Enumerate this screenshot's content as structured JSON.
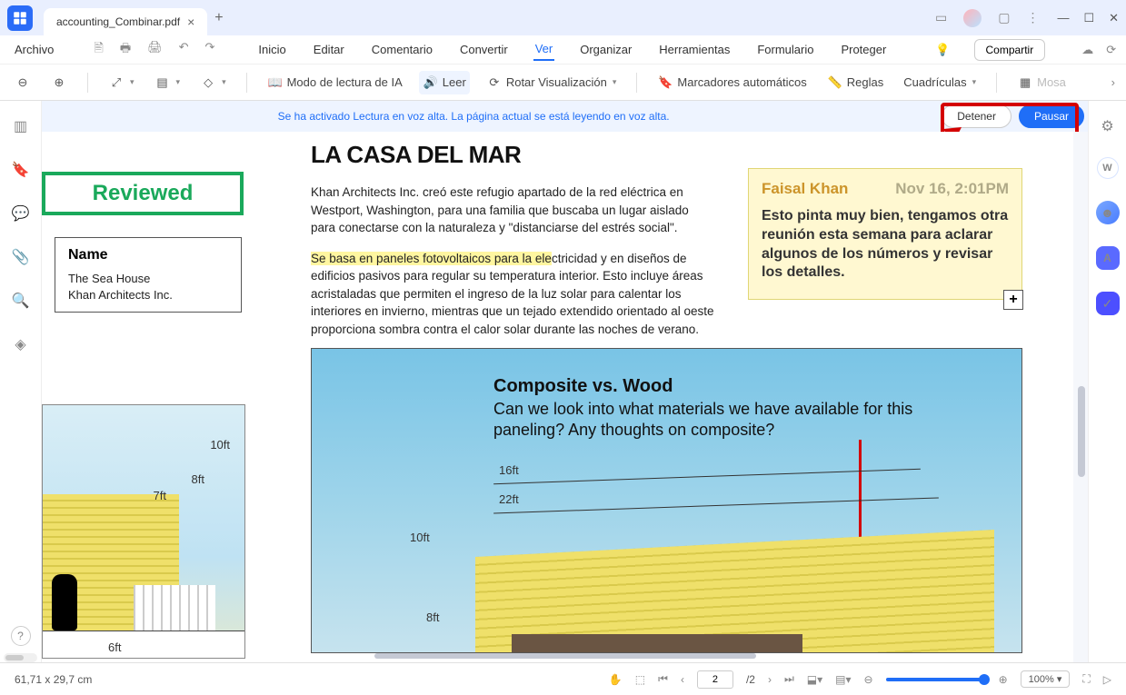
{
  "titlebar": {
    "tab_name": "accounting_Combinar.pdf"
  },
  "menu": {
    "file": "Archivo",
    "items": [
      "Inicio",
      "Editar",
      "Comentario",
      "Convertir",
      "Ver",
      "Organizar",
      "Herramientas",
      "Formulario",
      "Proteger"
    ],
    "active_index": 4,
    "share": "Compartir"
  },
  "toolbar": {
    "ai_read": "Modo de lectura de IA",
    "read": "Leer",
    "rotate": "Rotar Visualización",
    "bookmarks": "Marcadores automáticos",
    "rulers": "Reglas",
    "grids": "Cuadrículas",
    "mosaic": "Mosa"
  },
  "notify": {
    "msg": "Se ha activado Lectura en voz alta. La página actual se está leyendo en voz alta.",
    "stop": "Detener",
    "pause": "Pausar"
  },
  "doc": {
    "title": "LA CASA DEL MAR",
    "para1": "Khan Architects Inc. creó este refugio apartado de la red eléctrica en Westport, Washington, para una familia que buscaba un lugar aislado para conectarse con la naturaleza y \"distanciarse del estrés social\".",
    "para2_hl": "Se basa en paneles fotovoltaicos para la ele",
    "para2_rest": "ctricidad y en diseños de edificios pasivos para regular su temperatura interior. Esto incluye áreas acristaladas que permiten el ingreso de la luz solar para calentar los interiores en invierno, mientras que un tejado extendido orientado al oeste proporciona sombra contra el calor solar durante las noches de verano.",
    "reviewed": "Reviewed",
    "name_card": {
      "hdr": "Name",
      "line1": "The Sea House",
      "line2": "Khan Architects Inc."
    },
    "comment": {
      "author": "Faisal Khan",
      "ts": "Nov 16, 2:01PM",
      "body": "Esto pinta muy bien, tengamos otra reunión esta semana para aclarar algunos de los números y revisar los detalles."
    },
    "diagram_left": {
      "l10": "10ft",
      "l8": "8ft",
      "l7": "7ft",
      "l6": "6ft"
    },
    "diagram_main": {
      "h": "Composite vs. Wood",
      "sub": "Can we look into what materials we have available for this paneling? Any thoughts on composite?",
      "l16": "16ft",
      "l22": "22ft",
      "l10": "10ft",
      "l8": "8ft"
    }
  },
  "status": {
    "dims": "61,71 x 29,7 cm",
    "page_current": "2",
    "page_total": "/2",
    "zoom_pct": "100%"
  }
}
